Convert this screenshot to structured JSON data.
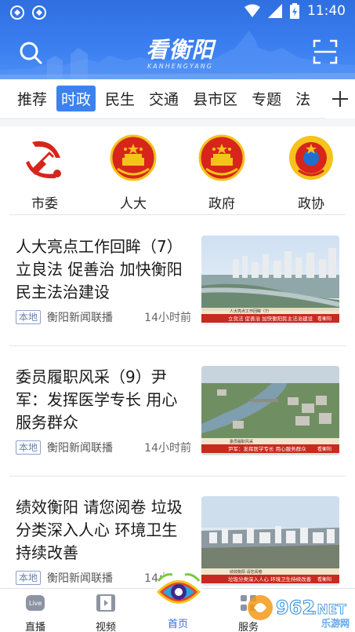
{
  "status_bar": {
    "time": "11:40"
  },
  "header": {
    "logo_text": "看衡阳",
    "logo_sub": "KANHENGYANG"
  },
  "tabs": [
    {
      "label": "推荐",
      "active": false
    },
    {
      "label": "时政",
      "active": true
    },
    {
      "label": "民生",
      "active": false
    },
    {
      "label": "交通",
      "active": false
    },
    {
      "label": "县市区",
      "active": false
    },
    {
      "label": "专题",
      "active": false
    },
    {
      "label": "法",
      "active": false
    }
  ],
  "quick_links": [
    {
      "label": "市委",
      "icon": "party-emblem-icon"
    },
    {
      "label": "人大",
      "icon": "national-emblem-icon"
    },
    {
      "label": "政府",
      "icon": "national-emblem-icon"
    },
    {
      "label": "政协",
      "icon": "cppcc-emblem-icon"
    }
  ],
  "news": [
    {
      "title": "人大亮点工作回眸（7）立良法 促善治 加快衡阳民主法治建设",
      "badge": "本地",
      "source": "衡阳新闻联播",
      "time": "14小时前",
      "caption_top": "人大亮点工作回眸（7）",
      "caption_main": "立良法 促善治 加快衡阳民主法治建设",
      "brand": "看衡阳"
    },
    {
      "title": "委员履职风采（9）尹军：发挥医学专长 用心服务群众",
      "badge": "本地",
      "source": "衡阳新闻联播",
      "time": "14小时前",
      "caption_top": "委员履职风采",
      "caption_main": "尹军：发挥医学专长 用心服务群众",
      "brand": "看衡阳"
    },
    {
      "title": "绩效衡阳 请您阅卷 垃圾分类深入人心 环境卫生持续改善",
      "badge": "本地",
      "source": "衡阳新闻联播",
      "time": "14小时前",
      "caption_top": "绩效衡阳 请您阅卷",
      "caption_main": "垃圾分类深入人心 环境卫生持续改善",
      "brand": "看衡阳"
    }
  ],
  "bottom_nav": [
    {
      "label": "直播",
      "icon": "live-tv-icon",
      "active": false
    },
    {
      "label": "视频",
      "icon": "film-icon",
      "active": false
    },
    {
      "label": "首页",
      "icon": "eye-logo-icon",
      "active": true
    },
    {
      "label": "服务",
      "icon": "grid-icon",
      "active": false
    }
  ],
  "watermark": {
    "text": "962",
    "suffix": ".NET",
    "sub": "乐游网"
  },
  "colors": {
    "brand_blue": "#2f6fe0",
    "active_tab": "#3b82f0",
    "party_red": "#d7251b",
    "emblem_gold": "#f6c21c"
  }
}
